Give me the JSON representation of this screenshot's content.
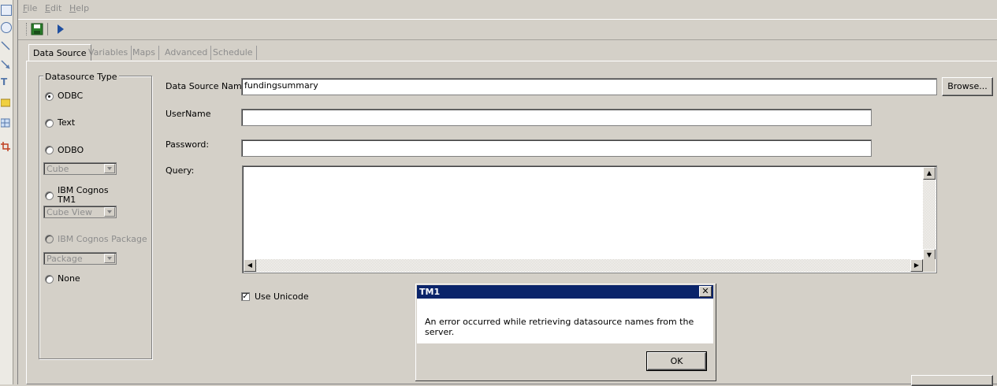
{
  "menu": [
    {
      "label": "File",
      "accel": "F",
      "rest": "ile"
    },
    {
      "label": "Edit",
      "accel": "E",
      "rest": "dit"
    },
    {
      "label": "Help",
      "accel": "H",
      "rest": "elp"
    }
  ],
  "tabs": [
    "Data Source",
    "Variables",
    "Maps",
    "Advanced",
    "Schedule"
  ],
  "datasource_type": {
    "title": "Datasource Type",
    "options": {
      "odbc": "ODBC",
      "text": "Text",
      "odbo": "ODBO",
      "cognos_tm1": "IBM Cognos TM1",
      "cognos_package": "IBM Cognos Package",
      "none": "None"
    },
    "selected": "ODBC",
    "cube_combo": "Cube",
    "cube_view_combo": "Cube View",
    "package_combo": "Package"
  },
  "form": {
    "ds_name_label": "Data Source Name:",
    "ds_name_value": "fundingsummary",
    "browse_label": "Browse...",
    "username_label": "UserName",
    "username_value": "",
    "password_label": "Password:",
    "password_value": "",
    "query_label": "Query:",
    "query_value": "",
    "unicode_label": "Use Unicode",
    "unicode_checked": true
  },
  "dialog": {
    "title": "TM1",
    "message": "An error occurred while retrieving datasource names from the server.",
    "ok_label": "OK",
    "close_glyph": "✕"
  },
  "colors": {
    "window_bg": "#d4d0c8",
    "dialog_title_bg": "#0a246a",
    "play_icon": "#1f4fa0",
    "save_icon": "#2a7d2a"
  }
}
